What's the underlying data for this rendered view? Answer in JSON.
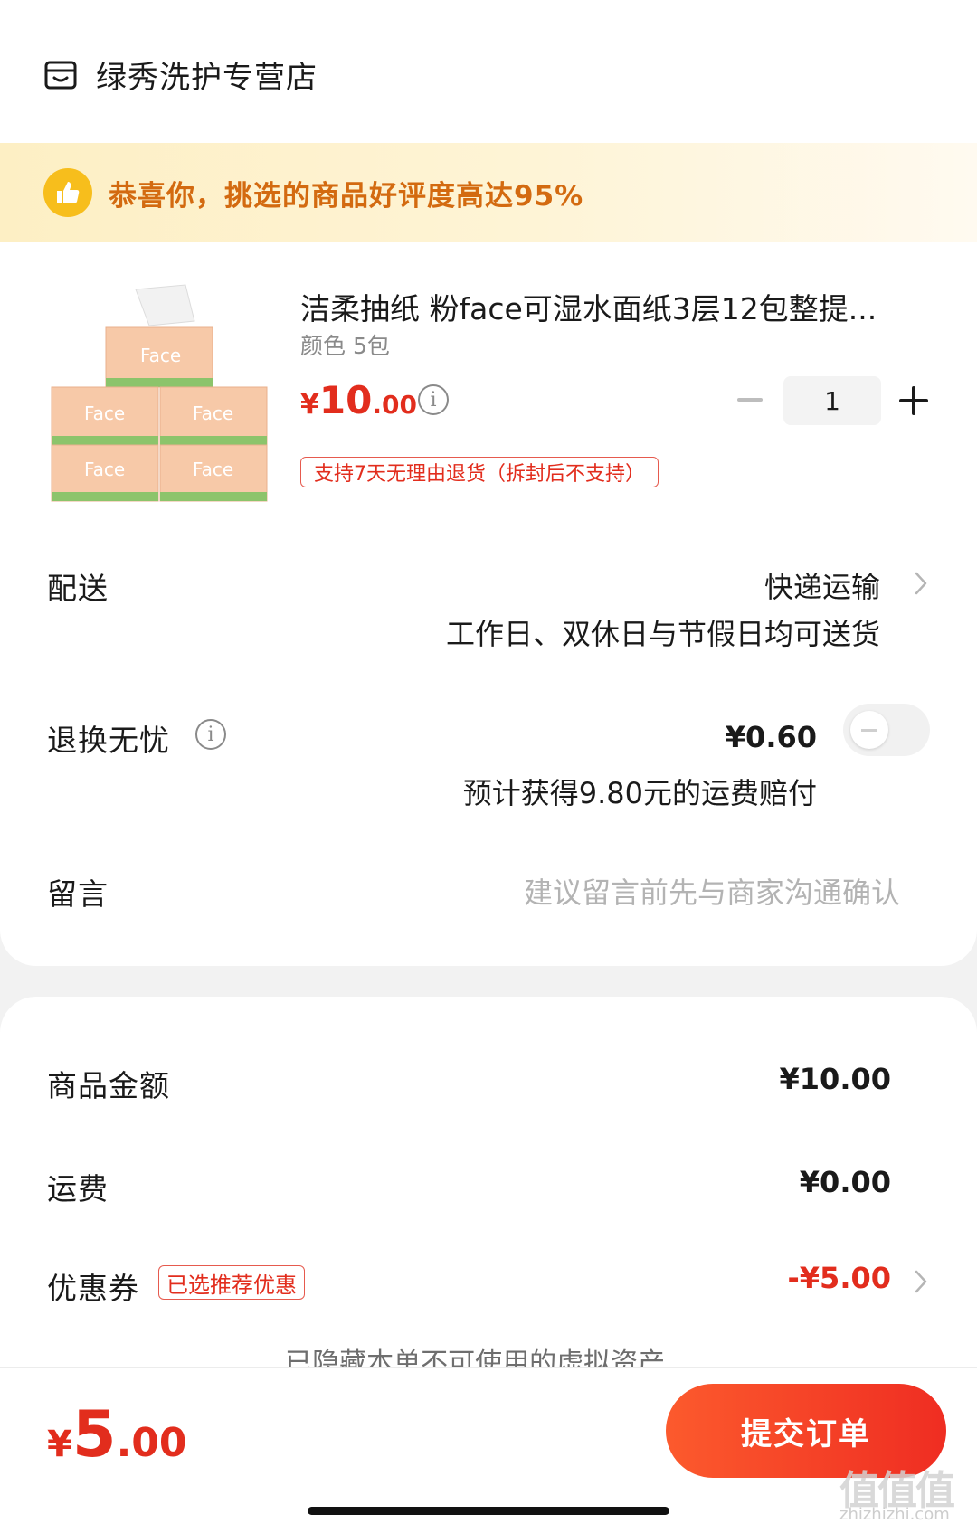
{
  "store": {
    "name": "绿秀洗护专营店",
    "icon": "store-icon"
  },
  "banner": {
    "text": "恭喜你，挑选的商品好评度高达95%",
    "icon": "thumbs-up-icon"
  },
  "product": {
    "title": "洁柔抽纸 粉face可湿水面纸3层12包整提...",
    "spec": "颜色 5包",
    "price_currency": "¥",
    "price_int": "10",
    "price_dec": ".00",
    "quantity": "1",
    "return_policy": "支持7天无理由退货（拆封后不支持）"
  },
  "delivery": {
    "label": "配送",
    "method": "快递运输",
    "note": "工作日、双休日与节假日均可送货"
  },
  "return_insurance": {
    "label": "退换无忧",
    "price": "¥0.60",
    "note": "预计获得9.80元的运费赔付",
    "enabled": false
  },
  "message": {
    "label": "留言",
    "placeholder": "建议留言前先与商家沟通确认"
  },
  "summary": {
    "goods_label": "商品金额",
    "goods_value": "¥10.00",
    "shipping_label": "运费",
    "shipping_value": "¥0.00",
    "coupon_label": "优惠券",
    "coupon_tag": "已选推荐优惠",
    "coupon_value": "-¥5.00",
    "hidden_note": "已隐藏本单不可使用的虚拟资产"
  },
  "footer": {
    "total_currency": "¥",
    "total_int": "5",
    "total_dec": ".00",
    "submit_label": "提交订单"
  },
  "watermark": {
    "text": "值值值",
    "sub": "zhizhizhi.com"
  },
  "colors": {
    "accent": "#e22d1d",
    "banner_text": "#d36a10",
    "banner_icon": "#f7be1c"
  }
}
